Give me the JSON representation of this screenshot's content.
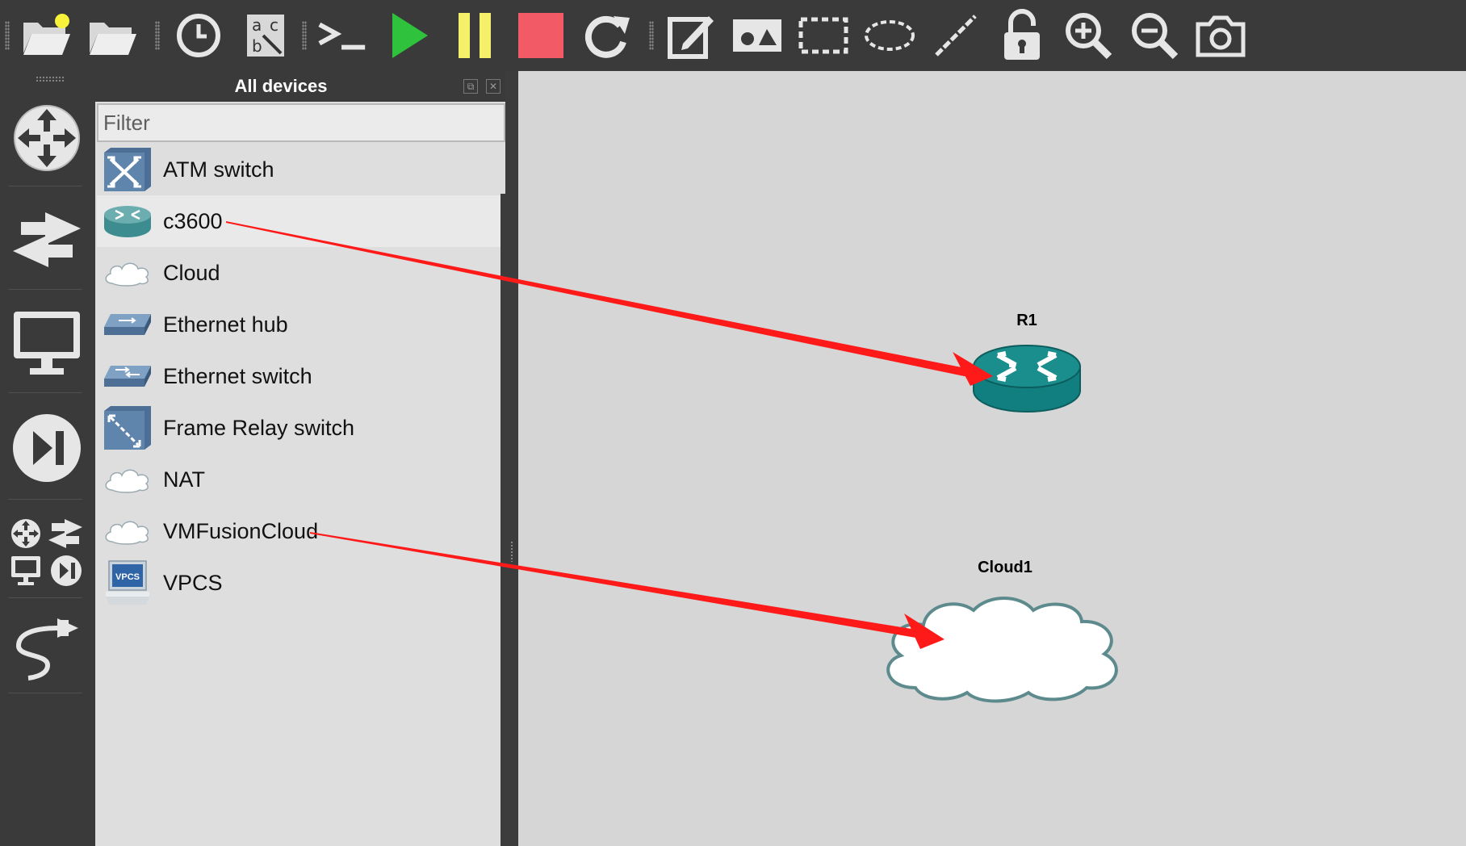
{
  "toolbar": {
    "items": [
      {
        "name": "new-project-icon"
      },
      {
        "name": "open-project-icon"
      },
      {
        "name": "snapshot-clock-icon"
      },
      {
        "name": "show-interface-labels-icon",
        "text": "a c b"
      },
      {
        "name": "console-icon",
        "text": ">_"
      },
      {
        "name": "start-icon"
      },
      {
        "name": "pause-icon"
      },
      {
        "name": "stop-icon"
      },
      {
        "name": "reload-icon"
      },
      {
        "name": "add-note-icon"
      },
      {
        "name": "insert-picture-icon"
      },
      {
        "name": "draw-rectangle-icon"
      },
      {
        "name": "draw-ellipse-icon"
      },
      {
        "name": "draw-line-icon"
      },
      {
        "name": "lock-icon"
      },
      {
        "name": "zoom-in-icon"
      },
      {
        "name": "zoom-out-icon"
      },
      {
        "name": "screenshot-icon"
      }
    ],
    "colors": {
      "start": "#2fc23c",
      "pause": "#f5f06a",
      "stop": "#f25b66"
    }
  },
  "sidebar": {
    "items": [
      "routers-icon",
      "switches-icon",
      "end-devices-icon",
      "security-devices-icon",
      "all-devices-icon",
      "add-link-icon"
    ]
  },
  "panel": {
    "title": "All devices",
    "filter_placeholder": "Filter",
    "devices": [
      {
        "label": "ATM switch",
        "icon": "atm-switch-icon"
      },
      {
        "label": "c3600",
        "icon": "router-icon"
      },
      {
        "label": "Cloud",
        "icon": "cloud-icon"
      },
      {
        "label": "Ethernet hub",
        "icon": "ethernet-hub-icon"
      },
      {
        "label": "Ethernet switch",
        "icon": "ethernet-switch-icon"
      },
      {
        "label": "Frame Relay switch",
        "icon": "frame-relay-switch-icon"
      },
      {
        "label": "NAT",
        "icon": "nat-cloud-icon"
      },
      {
        "label": "VMFusionCloud",
        "icon": "vmfusion-cloud-icon"
      },
      {
        "label": "VPCS",
        "icon": "vpcs-icon",
        "icon_text": "VPCS"
      }
    ]
  },
  "canvas": {
    "nodes": [
      {
        "label": "R1",
        "icon": "router-icon",
        "color": "#117f7f"
      },
      {
        "label": "Cloud1",
        "icon": "cloud-icon",
        "color": "#ffffff"
      }
    ],
    "annotation_color": "#ff1a1a"
  }
}
